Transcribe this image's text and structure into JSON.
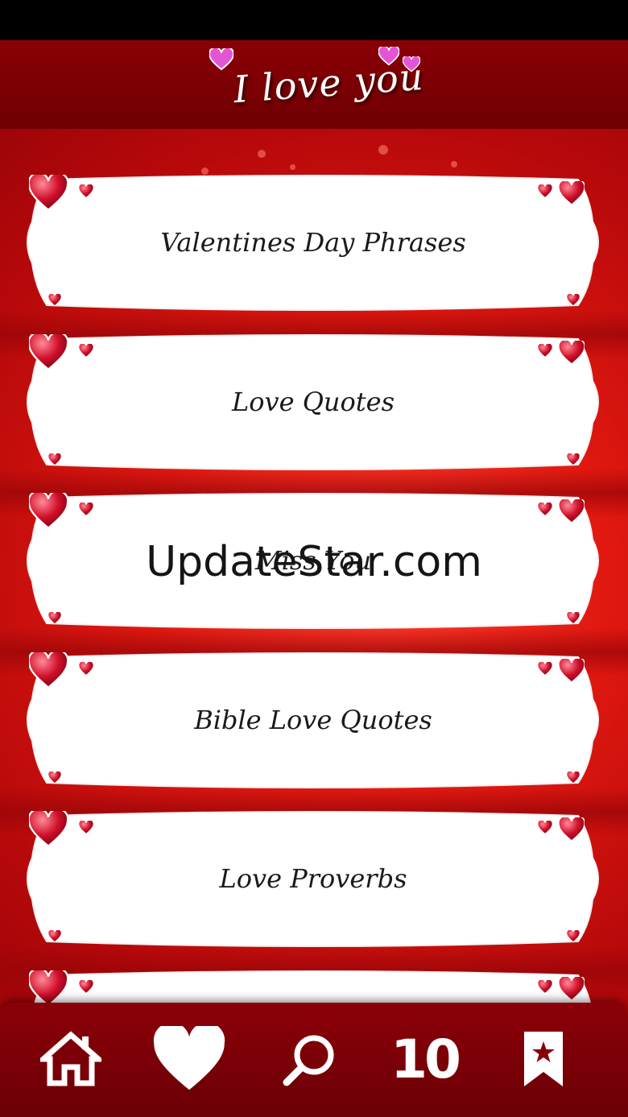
{
  "app": {
    "title": "I love you"
  },
  "menu": {
    "items": [
      {
        "label": "Valentines Day Phrases"
      },
      {
        "label": "Love Quotes"
      },
      {
        "label": "Miss You"
      },
      {
        "label": "Bible Love Quotes"
      },
      {
        "label": "Love Proverbs"
      },
      {
        "label": ""
      }
    ]
  },
  "watermark": "UpdateStar.com",
  "bottom_nav": {
    "items": [
      {
        "icon": "home-icon"
      },
      {
        "icon": "heart-icon"
      },
      {
        "icon": "search-icon"
      },
      {
        "icon": "top-ten-icon",
        "label": "10"
      },
      {
        "icon": "bookmark-star-icon"
      }
    ]
  },
  "colors": {
    "header": "#7a0004",
    "background": "#d41410",
    "card": "#ffffff",
    "heart": "#c8102e",
    "logo_heart": "#e040d0"
  }
}
